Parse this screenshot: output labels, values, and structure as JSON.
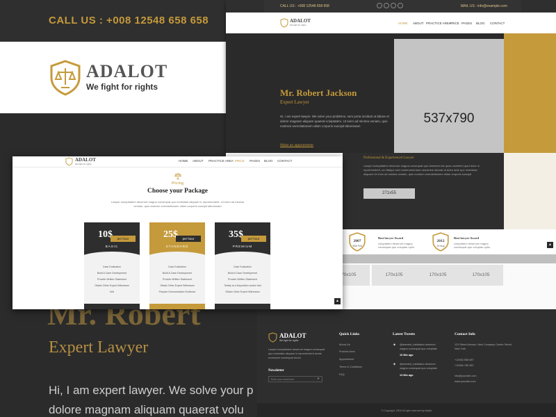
{
  "background": {
    "call_us": "CALL US :   +008 12548 658 658",
    "logo_name": "ADALOT",
    "logo_tagline": "We fight for rights",
    "hero_name": "Mr. Robert",
    "hero_role": "Expert Lawyer",
    "hero_desc_line1": "Hi, I am expert lawyer. We solve your p",
    "hero_desc_line2": "dolore magnam aliquam quaerat volu"
  },
  "hero_shot": {
    "call": "CALL US : +008 12548 658 658",
    "mail": "MAIL US : info@example.com",
    "logo_name": "ADALOT",
    "logo_tagline": "We fight for rights",
    "nav": [
      "HOME",
      "ABOUT",
      "PRACTICE AREA",
      "PRICE",
      "PAGES",
      "BLOG",
      "CONTACT"
    ],
    "name": "Mr. Robert Jackson",
    "role": "Expert Lawyer",
    "desc": "Hi, I am expert lawyer. We solve your problems, sem porta incidunt ut labore et dolore magnam aliquam quaerat voluptatem. Ut enim ad minima veniam, quis nostrum exercitationem ullam corporis suscipit laboriosam",
    "link": "Make an appointment",
    "photo_label": "537x790"
  },
  "about_shot": {
    "title": "Professional & Experienced Lawyer",
    "desc": "Lawyer loolupttatem deserunt magna consequat quo deserere est quos ommitem aput dolor in reprehenderit, um fatique sed numeroimentum ramoinem laborat ut dolor ante quo molestiae aliquam Ut enim ad minima veniam, quis nostrum exercitationem ullam corporis suscipit",
    "button_label": "271x55",
    "awards": [
      {
        "year": "2007",
        "date": "30th Feb",
        "title": "Best lawyer Award",
        "desc": "voluptatem deserunt magna consequat quo voluptas optio"
      },
      {
        "year": "2012",
        "date": "22 Aug",
        "title": "Best lawyer Award",
        "desc": "voluptatem deserunt magna consequat quo voluptas optio"
      }
    ],
    "tiles": [
      "170x105",
      "170x105",
      "170x105",
      "170x105"
    ]
  },
  "footer_shot": {
    "logo_name": "ADALOT",
    "logo_tagline": "We fight for rights",
    "about": "Lawyer loolupttatem deserunt magna consequat quo molestiae aliquam in reprehenderit seeds excessum consequat locum",
    "newsletter": "Newsletter",
    "newsletter_placeholder": "Enter your email here",
    "quick_links_title": "Quick Links",
    "quick_links": [
      "About Us",
      "Practice Area",
      "Appointment",
      "Terms & Conditions",
      "FAQ"
    ],
    "tweets_title": "Latest Tweets",
    "tweets": [
      {
        "text": "@tweeted_habitation deserunt magna consequat quo voluptate",
        "time": "10 Min ago"
      },
      {
        "text": "@tweeted_habitation deserunt magna consequat quo voluptate",
        "time": "13 Min ago"
      }
    ],
    "contact_title": "Contact Info",
    "contact": [
      "123 Street Avenue, New Company Centre Street, New York",
      "+12546 598 587",
      "+12546 789 987",
      "info@yoursite.com",
      "www.yoursite.com"
    ],
    "copyright": "© Copyright, 2016 All right reserved by Adalot"
  },
  "pricing_shot": {
    "logo_name": "ADALOT",
    "logo_tagline": "We fight for rights",
    "nav": [
      "HOME",
      "ABOUT",
      "PRACTICE AREA",
      "PRICE",
      "PAGES",
      "BLOG",
      "CONTACT"
    ],
    "label": "Pricing",
    "title": "Choose your Package",
    "desc": "Lawyer loolupttatem deserunt magna consequat quo molestiae aliquam in reprehenderit. Ut enim ad minima veniam, quis nostrum exercitationem ullam corporis suscipit laboriosam",
    "plans": [
      {
        "price": "10$",
        "per": "per hour",
        "tier": "BASIC",
        "features": [
          "Case Evaluation",
          "Build A Case Development",
          "Provide Written Statement",
          "Obtain Other Expert Witnesses",
          "N/A"
        ]
      },
      {
        "price": "25$",
        "per": "per hour",
        "tier": "STANDARD",
        "features": [
          "Case Evaluation",
          "Build A Case Development",
          "Provide Written Statement",
          "Obtain Other Expert Witnesses",
          "Prepare Demonstrative Evidence"
        ]
      },
      {
        "price": "35$",
        "per": "per hour",
        "tier": "PREMIUM",
        "features": [
          "Case Evaluation",
          "Build A Case Development",
          "Provide Written Statement",
          "Testify at a Deposition and/or trial",
          "Obtain Other Expert Witnesses"
        ]
      }
    ]
  },
  "colors": {
    "gold": "#c59a3b",
    "dark": "#2b2b2b"
  }
}
